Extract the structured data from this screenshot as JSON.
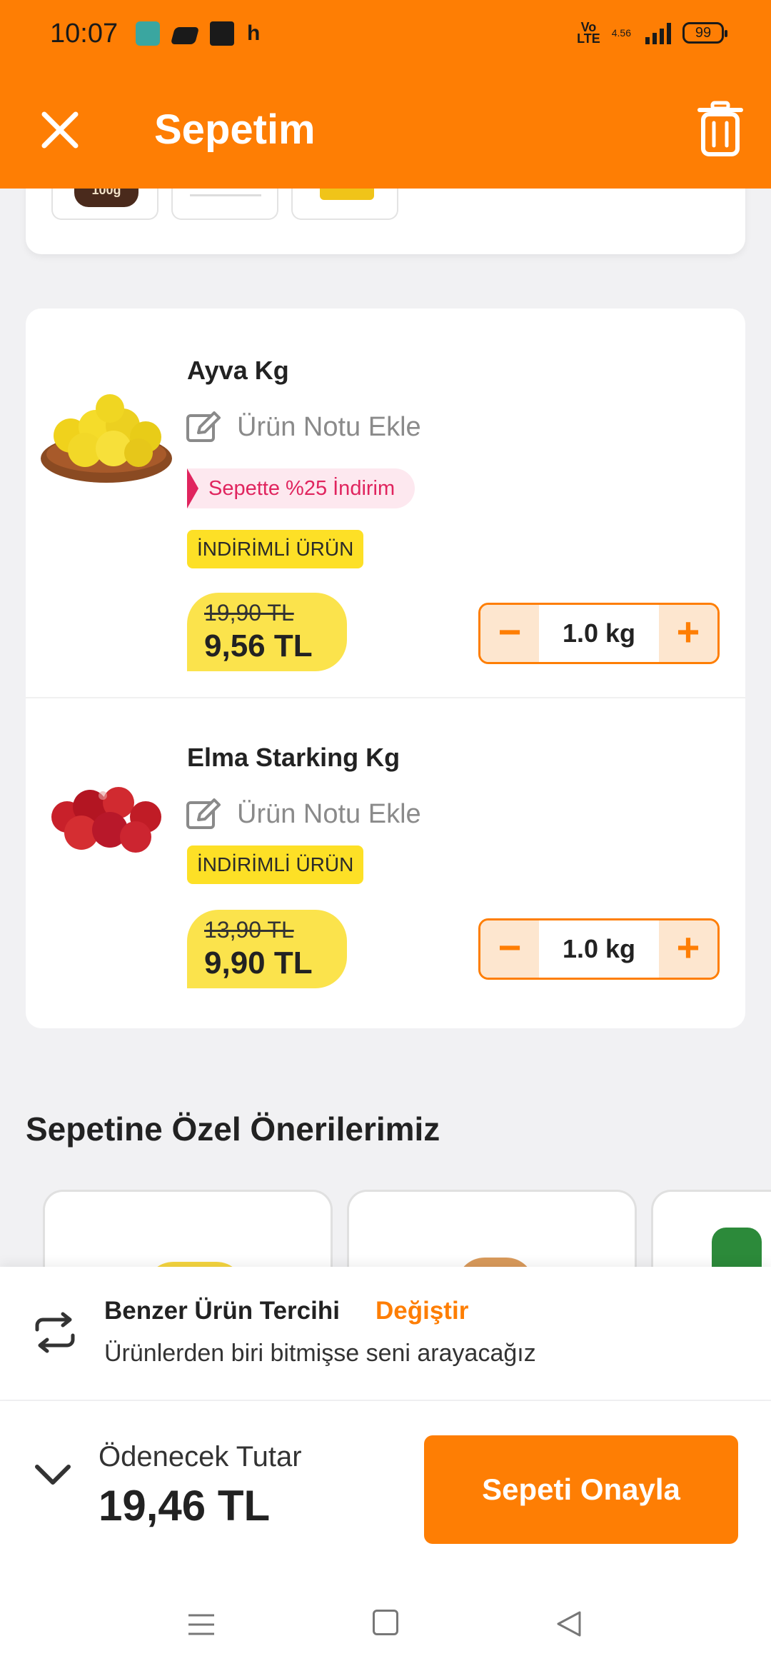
{
  "status_bar": {
    "time": "10:07",
    "letter": "h",
    "volte": "Vo\nLTE",
    "network": "4.56",
    "battery": "99"
  },
  "header": {
    "title": "Sepetim",
    "close_icon": "close-icon",
    "trash_icon": "trash-icon"
  },
  "top_card": {
    "thumb1_label": "100g"
  },
  "cart": {
    "items": [
      {
        "name": "Ayva Kg",
        "note_label": "Ürün Notu Ekle",
        "discount_label": "Sepette %25 İndirim",
        "tag": "İNDİRİMLİ ÜRÜN",
        "old_price": "19,90 TL",
        "new_price": "9,56 TL",
        "quantity": "1.0 kg",
        "minus": "−",
        "plus": "+"
      },
      {
        "name": "Elma Starking Kg",
        "note_label": "Ürün Notu Ekle",
        "tag": "İNDİRİMLİ ÜRÜN",
        "old_price": "13,90 TL",
        "new_price": "9,90 TL",
        "quantity": "1.0 kg",
        "minus": "−",
        "plus": "+"
      }
    ]
  },
  "recommendations": {
    "title": "Sepetine Özel Önerilerimiz"
  },
  "preference": {
    "title": "Benzer Ürün Tercihi",
    "link": "Değiştir",
    "description": "Ürünlerden biri bitmişse seni arayacağız"
  },
  "payment": {
    "label": "Ödenecek Tutar",
    "total": "19,46 TL",
    "confirm_label": "Sepeti Onayla"
  },
  "colors": {
    "brand_orange": "#fe7e04",
    "price_yellow": "#fbe34c",
    "discount_pink": "#e0245e"
  }
}
